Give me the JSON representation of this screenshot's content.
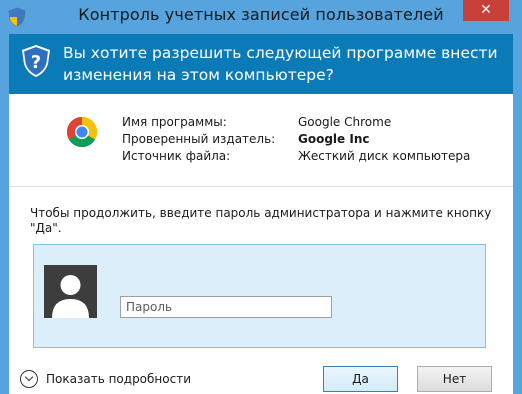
{
  "window": {
    "title": "Контроль учетных записей пользователей",
    "close_label": "✕"
  },
  "banner": {
    "question": "Вы хотите разрешить следующей программе внести изменения на этом компьютере?"
  },
  "program": {
    "icon": "chrome-icon",
    "rows": [
      {
        "label": "Имя программы:",
        "value": "Google Chrome"
      },
      {
        "label": "Проверенный издатель:",
        "value": "Google Inc"
      },
      {
        "label": "Источник файла:",
        "value": "Жесткий диск компьютера"
      }
    ]
  },
  "prompt": "Чтобы продолжить, введите пароль администратора и нажмите кнопку \"Да\".",
  "credentials": {
    "password_placeholder": "Пароль",
    "password_value": ""
  },
  "footer": {
    "details_label": "Показать подробности",
    "yes_label": "Да",
    "no_label": "Нет"
  },
  "colors": {
    "title_bar": "#56a3dd",
    "banner": "#0a7bb7",
    "close_button": "#c7403a",
    "credential_box": "#dbeef9"
  }
}
